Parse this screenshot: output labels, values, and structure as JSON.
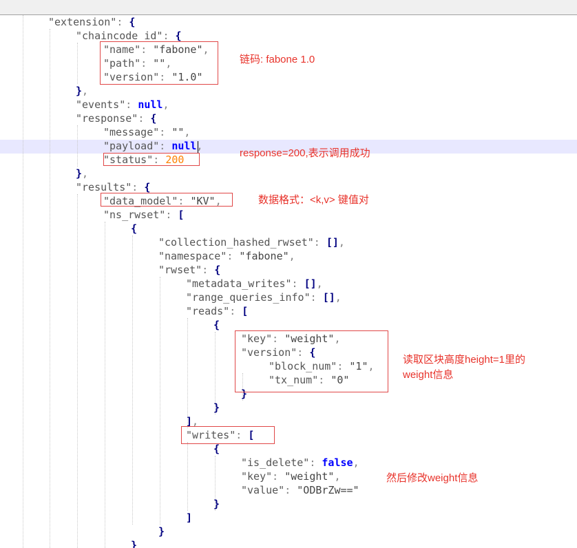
{
  "editor": {
    "lines": [
      {
        "i": 0,
        "tokens": [
          {
            "t": "k",
            "v": "\"extension\""
          },
          {
            "t": "punc",
            "v": ": "
          },
          {
            "t": "p",
            "v": "{"
          }
        ]
      },
      {
        "i": 1,
        "tokens": [
          {
            "t": "k",
            "v": "\"chaincode_id\""
          },
          {
            "t": "punc",
            "v": ": "
          },
          {
            "t": "p",
            "v": "{"
          }
        ]
      },
      {
        "i": 2,
        "tokens": [
          {
            "t": "k",
            "v": "\"name\""
          },
          {
            "t": "punc",
            "v": ": "
          },
          {
            "t": "s",
            "v": "\"fabone\""
          },
          {
            "t": "punc",
            "v": ","
          }
        ]
      },
      {
        "i": 2,
        "tokens": [
          {
            "t": "k",
            "v": "\"path\""
          },
          {
            "t": "punc",
            "v": ": "
          },
          {
            "t": "s",
            "v": "\"\""
          },
          {
            "t": "punc",
            "v": ","
          }
        ]
      },
      {
        "i": 2,
        "tokens": [
          {
            "t": "k",
            "v": "\"version\""
          },
          {
            "t": "punc",
            "v": ": "
          },
          {
            "t": "s",
            "v": "\"1.0\""
          }
        ]
      },
      {
        "i": 1,
        "tokens": [
          {
            "t": "p",
            "v": "}"
          },
          {
            "t": "punc",
            "v": ","
          }
        ]
      },
      {
        "i": 1,
        "tokens": [
          {
            "t": "k",
            "v": "\"events\""
          },
          {
            "t": "punc",
            "v": ": "
          },
          {
            "t": "n",
            "v": "null"
          },
          {
            "t": "punc",
            "v": ","
          }
        ]
      },
      {
        "i": 1,
        "tokens": [
          {
            "t": "k",
            "v": "\"response\""
          },
          {
            "t": "punc",
            "v": ": "
          },
          {
            "t": "p",
            "v": "{"
          }
        ]
      },
      {
        "i": 2,
        "tokens": [
          {
            "t": "k",
            "v": "\"message\""
          },
          {
            "t": "punc",
            "v": ": "
          },
          {
            "t": "s",
            "v": "\"\""
          },
          {
            "t": "punc",
            "v": ","
          }
        ]
      },
      {
        "i": 2,
        "tokens": [
          {
            "t": "k",
            "v": "\"payload\""
          },
          {
            "t": "punc",
            "v": ": "
          },
          {
            "t": "n",
            "v": "null"
          },
          {
            "t": "punc",
            "v": ","
          }
        ]
      },
      {
        "i": 2,
        "tokens": [
          {
            "t": "k",
            "v": "\"status\""
          },
          {
            "t": "punc",
            "v": ": "
          },
          {
            "t": "num",
            "v": "200"
          }
        ]
      },
      {
        "i": 1,
        "tokens": [
          {
            "t": "p",
            "v": "}"
          },
          {
            "t": "punc",
            "v": ","
          }
        ]
      },
      {
        "i": 1,
        "tokens": [
          {
            "t": "k",
            "v": "\"results\""
          },
          {
            "t": "punc",
            "v": ": "
          },
          {
            "t": "p",
            "v": "{"
          }
        ]
      },
      {
        "i": 2,
        "tokens": [
          {
            "t": "k",
            "v": "\"data_model\""
          },
          {
            "t": "punc",
            "v": ": "
          },
          {
            "t": "s",
            "v": "\"KV\""
          },
          {
            "t": "punc",
            "v": ","
          }
        ]
      },
      {
        "i": 2,
        "tokens": [
          {
            "t": "k",
            "v": "\"ns_rwset\""
          },
          {
            "t": "punc",
            "v": ": "
          },
          {
            "t": "p",
            "v": "["
          }
        ]
      },
      {
        "i": 3,
        "tokens": [
          {
            "t": "p",
            "v": "{"
          }
        ]
      },
      {
        "i": 4,
        "tokens": [
          {
            "t": "k",
            "v": "\"collection_hashed_rwset\""
          },
          {
            "t": "punc",
            "v": ": "
          },
          {
            "t": "p",
            "v": "[]"
          },
          {
            "t": "punc",
            "v": ","
          }
        ]
      },
      {
        "i": 4,
        "tokens": [
          {
            "t": "k",
            "v": "\"namespace\""
          },
          {
            "t": "punc",
            "v": ": "
          },
          {
            "t": "s",
            "v": "\"fabone\""
          },
          {
            "t": "punc",
            "v": ","
          }
        ]
      },
      {
        "i": 4,
        "tokens": [
          {
            "t": "k",
            "v": "\"rwset\""
          },
          {
            "t": "punc",
            "v": ": "
          },
          {
            "t": "p",
            "v": "{"
          }
        ]
      },
      {
        "i": 5,
        "tokens": [
          {
            "t": "k",
            "v": "\"metadata_writes\""
          },
          {
            "t": "punc",
            "v": ": "
          },
          {
            "t": "p",
            "v": "[]"
          },
          {
            "t": "punc",
            "v": ","
          }
        ]
      },
      {
        "i": 5,
        "tokens": [
          {
            "t": "k",
            "v": "\"range_queries_info\""
          },
          {
            "t": "punc",
            "v": ": "
          },
          {
            "t": "p",
            "v": "[]"
          },
          {
            "t": "punc",
            "v": ","
          }
        ]
      },
      {
        "i": 5,
        "tokens": [
          {
            "t": "k",
            "v": "\"reads\""
          },
          {
            "t": "punc",
            "v": ": "
          },
          {
            "t": "p",
            "v": "["
          }
        ]
      },
      {
        "i": 6,
        "tokens": [
          {
            "t": "p",
            "v": "{"
          }
        ]
      },
      {
        "i": 7,
        "tokens": [
          {
            "t": "k",
            "v": "\"key\""
          },
          {
            "t": "punc",
            "v": ": "
          },
          {
            "t": "s",
            "v": "\"weight\""
          },
          {
            "t": "punc",
            "v": ","
          }
        ]
      },
      {
        "i": 7,
        "tokens": [
          {
            "t": "k",
            "v": "\"version\""
          },
          {
            "t": "punc",
            "v": ": "
          },
          {
            "t": "p",
            "v": "{"
          }
        ]
      },
      {
        "i": 8,
        "tokens": [
          {
            "t": "k",
            "v": "\"block_num\""
          },
          {
            "t": "punc",
            "v": ": "
          },
          {
            "t": "s",
            "v": "\"1\""
          },
          {
            "t": "punc",
            "v": ","
          }
        ]
      },
      {
        "i": 8,
        "tokens": [
          {
            "t": "k",
            "v": "\"tx_num\""
          },
          {
            "t": "punc",
            "v": ": "
          },
          {
            "t": "s",
            "v": "\"0\""
          }
        ]
      },
      {
        "i": 7,
        "tokens": [
          {
            "t": "p",
            "v": "}"
          }
        ]
      },
      {
        "i": 6,
        "tokens": [
          {
            "t": "p",
            "v": "}"
          }
        ]
      },
      {
        "i": 5,
        "tokens": [
          {
            "t": "p",
            "v": "]"
          },
          {
            "t": "punc",
            "v": ","
          }
        ]
      },
      {
        "i": 5,
        "tokens": [
          {
            "t": "k",
            "v": "\"writes\""
          },
          {
            "t": "punc",
            "v": ": "
          },
          {
            "t": "p",
            "v": "["
          }
        ]
      },
      {
        "i": 6,
        "tokens": [
          {
            "t": "p",
            "v": "{"
          }
        ]
      },
      {
        "i": 7,
        "tokens": [
          {
            "t": "k",
            "v": "\"is_delete\""
          },
          {
            "t": "punc",
            "v": ": "
          },
          {
            "t": "n",
            "v": "false"
          },
          {
            "t": "punc",
            "v": ","
          }
        ]
      },
      {
        "i": 7,
        "tokens": [
          {
            "t": "k",
            "v": "\"key\""
          },
          {
            "t": "punc",
            "v": ": "
          },
          {
            "t": "s",
            "v": "\"weight\""
          },
          {
            "t": "punc",
            "v": ","
          }
        ]
      },
      {
        "i": 7,
        "tokens": [
          {
            "t": "k",
            "v": "\"value\""
          },
          {
            "t": "punc",
            "v": ": "
          },
          {
            "t": "s",
            "v": "\"ODBrZw==\""
          }
        ]
      },
      {
        "i": 6,
        "tokens": [
          {
            "t": "p",
            "v": "}"
          }
        ]
      },
      {
        "i": 5,
        "tokens": [
          {
            "t": "p",
            "v": "]"
          }
        ]
      },
      {
        "i": 4,
        "tokens": [
          {
            "t": "p",
            "v": "}"
          }
        ]
      },
      {
        "i": 3,
        "tokens": [
          {
            "t": "p",
            "v": "}"
          }
        ]
      }
    ]
  },
  "annotations": {
    "chaincode": "链码: fabone 1.0",
    "response": "response=200,表示调用成功",
    "data_model": "数据格式：<k,v> 键值对",
    "reads_line1": "读取区块高度height=1里的",
    "reads_line2": "weight信息",
    "writes": "然后修改weight信息"
  },
  "colors": {
    "annotation": "#e8322a",
    "box": "#e04646",
    "current_line": "#e8e8ff",
    "keyword": "#0000ff",
    "number": "#ff8000",
    "bracket": "#000080"
  }
}
